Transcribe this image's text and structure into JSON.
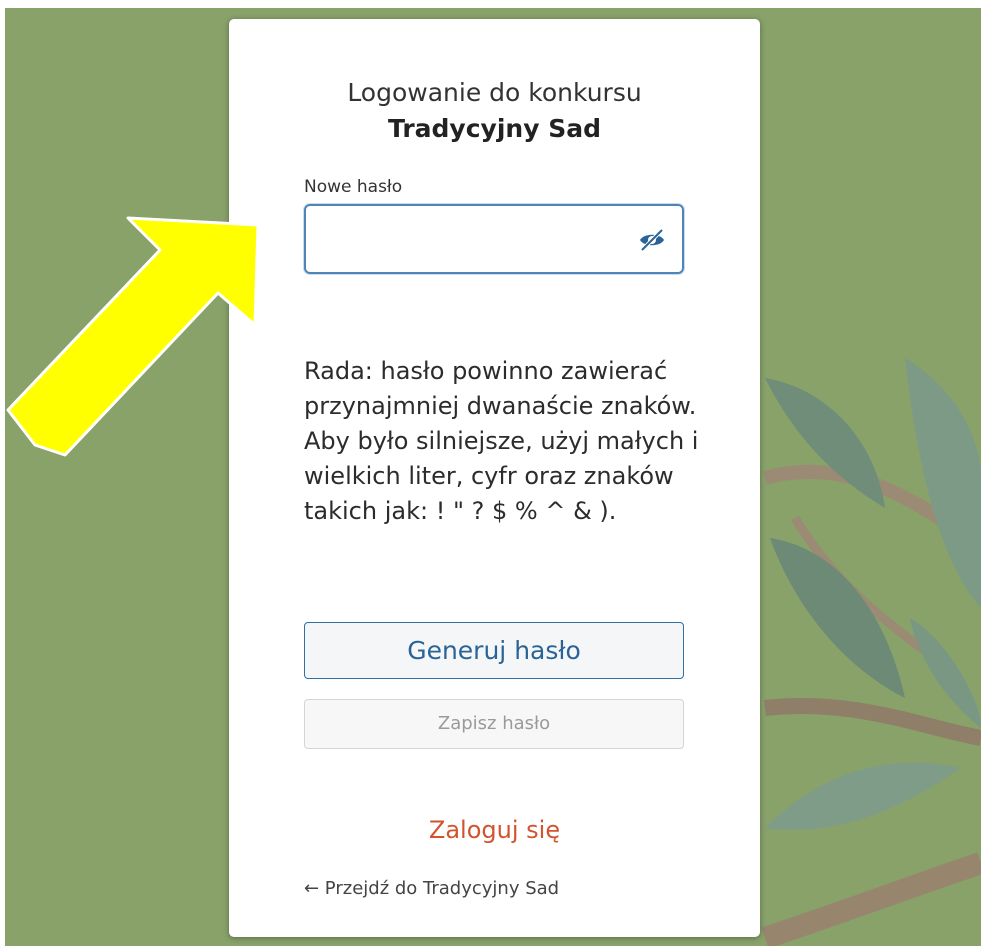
{
  "page": {
    "title_line1": "Logowanie do konkursu",
    "title_line2": "Tradycyjny Sad"
  },
  "password": {
    "label": "Nowe hasło",
    "value": "",
    "toggle_icon": "eye-slash-icon"
  },
  "hint": "Rada: hasło powinno zawierać przynajmniej dwanaście znaków. Aby było silniejsze, użyj małych i wielkich liter, cyfr oraz znaków takich jak: ! \" ? $ % ^ & ).",
  "buttons": {
    "generate": "Generuj hasło",
    "save": "Zapisz hasło"
  },
  "links": {
    "login": "Zaloguj się",
    "back": "← Przejdź do Tradycyjny Sad"
  },
  "colors": {
    "background": "#88a26a",
    "accent": "#2a6496",
    "link": "#d1542f",
    "annotation_arrow": "#ffff00"
  }
}
